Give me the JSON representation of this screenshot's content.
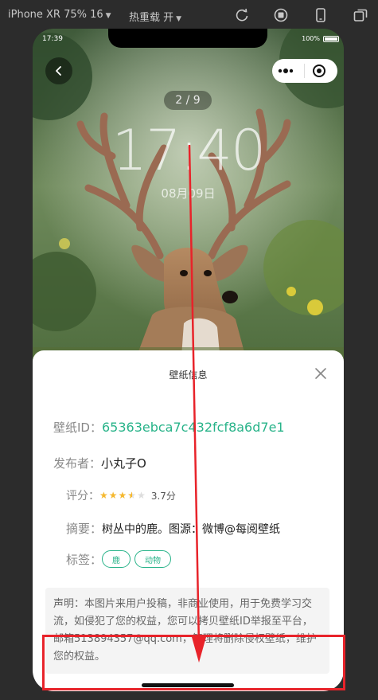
{
  "toolbar": {
    "device": "iPhone XR 75% 16",
    "hot_reload": "热重载 开",
    "icons": [
      "refresh-icon",
      "record-icon",
      "phone-icon",
      "windows-icon"
    ]
  },
  "statusbar": {
    "time": "17:39",
    "battery": "100%"
  },
  "nav": {
    "back_icon": "chevron-left-icon",
    "menu_icon": "more-dots-icon",
    "target_icon": "target-icon"
  },
  "overlay": {
    "counter": "2 / 9",
    "time": "17:40",
    "date": "08月09日"
  },
  "sheet": {
    "title": "壁纸信息",
    "close_icon": "close-icon",
    "id_label": "壁纸ID：",
    "id_value": "65363ebca7c432fcf8a6d7e1",
    "publisher_label": "发布者：",
    "publisher_value": "小丸子O",
    "rating_label": "评分：",
    "rating_value": 3.5,
    "rating_max": 5,
    "rating_text": "3.7分",
    "summary_label": "摘要：",
    "summary_value": "树丛中的鹿。图源：微博@每阅壁纸",
    "tags_label": "标签：",
    "tags": [
      "鹿",
      "动物"
    ],
    "notice": "声明：本图片来用户投稿，非商业使用，用于免费学习交流，如侵犯了您的权益，您可以拷贝壁纸ID举报至平台，邮箱513894357@qq.com，管理将删除侵权壁纸，维护您的权益。"
  },
  "colors": {
    "accent": "#28b389",
    "annotation": "#e8232a",
    "star": "#f5b82e"
  }
}
